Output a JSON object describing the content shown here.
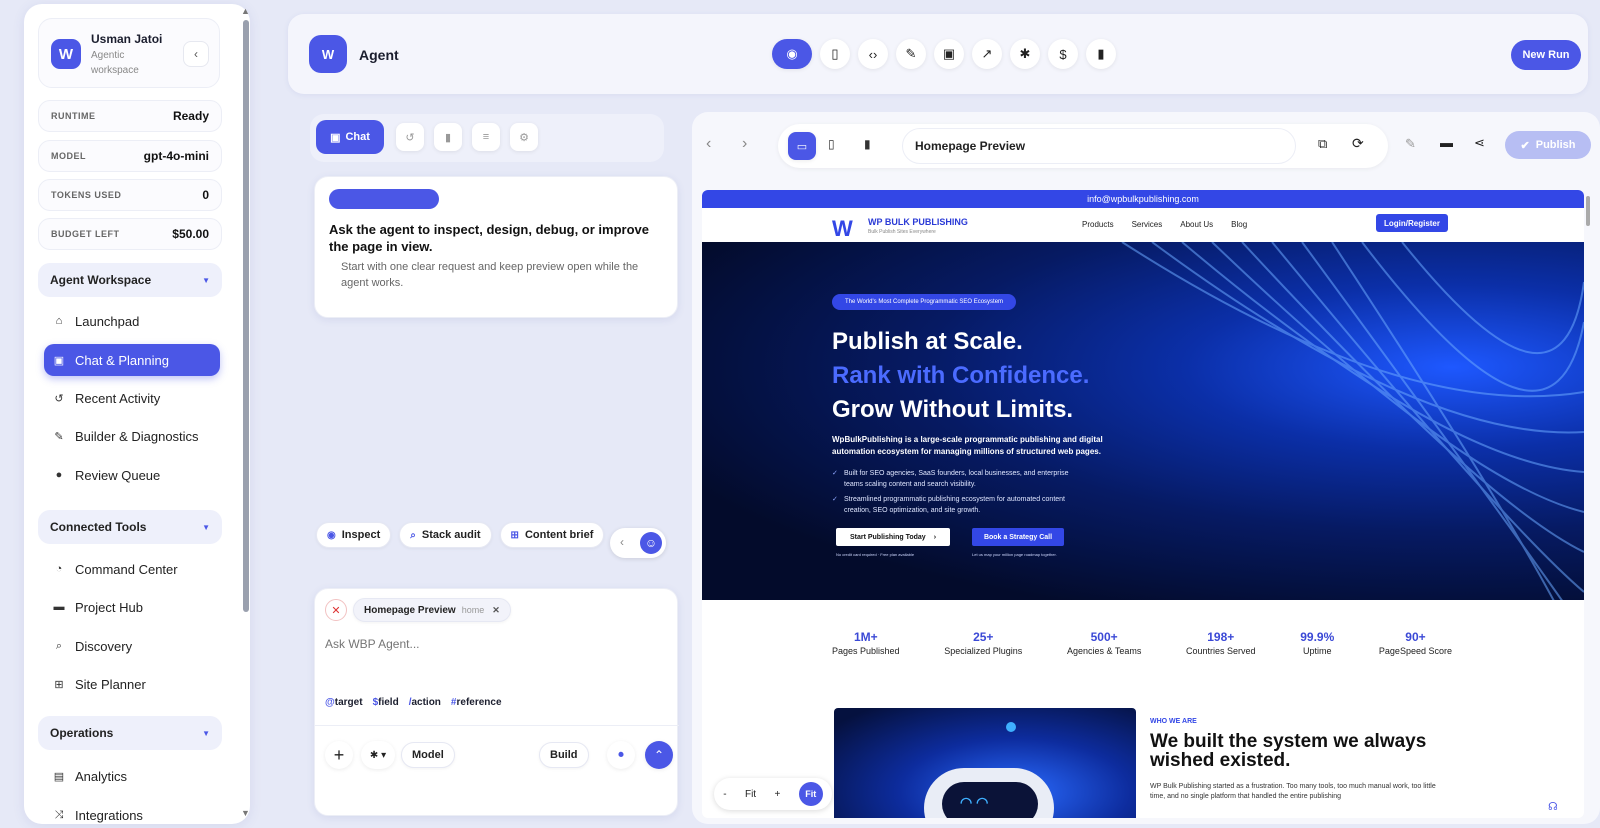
{
  "sidebar": {
    "user": {
      "initial": "W",
      "name": "Usman Jatoi",
      "subtitle": "Agentic workspace"
    },
    "stats": [
      {
        "key": "RUNTIME",
        "value": "Ready"
      },
      {
        "key": "MODEL",
        "value": "gpt-4o-mini"
      },
      {
        "key": "TOKENS USED",
        "value": "0"
      },
      {
        "key": "BUDGET LEFT",
        "value": "$50.00"
      }
    ],
    "sections": [
      {
        "title": "Agent Workspace",
        "items": [
          {
            "label": "Launchpad",
            "icon": "home-icon"
          },
          {
            "label": "Chat & Planning",
            "icon": "chat-icon",
            "active": true
          },
          {
            "label": "Recent Activity",
            "icon": "history-icon"
          },
          {
            "label": "Builder & Diagnostics",
            "icon": "wrench-icon"
          },
          {
            "label": "Review Queue",
            "icon": "check-circle-icon"
          }
        ]
      },
      {
        "title": "Connected Tools",
        "items": [
          {
            "label": "Command Center",
            "icon": "gauge-icon"
          },
          {
            "label": "Project Hub",
            "icon": "folder-icon"
          },
          {
            "label": "Discovery",
            "icon": "search-icon"
          },
          {
            "label": "Site Planner",
            "icon": "sitemap-icon"
          }
        ]
      },
      {
        "title": "Operations",
        "items": [
          {
            "label": "Analytics",
            "icon": "chart-icon"
          },
          {
            "label": "Integrations",
            "icon": "shuffle-icon"
          }
        ]
      }
    ]
  },
  "topbar": {
    "initial": "W",
    "title": "Agent",
    "new_run": "New Run"
  },
  "chat": {
    "tab_label": "Chat",
    "prompt_title": "Ask the agent to inspect, design, debug, or improve the page in view.",
    "prompt_sub": "Start with one clear request and keep preview open while the agent works.",
    "quick_actions": [
      "Inspect",
      "Stack audit",
      "Content brief"
    ],
    "context_chip": {
      "label": "Homepage Preview",
      "tag": "home"
    },
    "input_placeholder": "Ask WBP Agent...",
    "hints": [
      {
        "sym": "@",
        "word": "target"
      },
      {
        "sym": "$",
        "word": "field"
      },
      {
        "sym": "/",
        "word": "action"
      },
      {
        "sym": "#",
        "word": "reference"
      }
    ],
    "model_label": "Model",
    "build_label": "Build"
  },
  "preview": {
    "address": "Homepage Preview",
    "publish": "Publish",
    "zoom": {
      "minus": "-",
      "fit": "Fit",
      "plus": "+",
      "fit_active": "Fit"
    }
  },
  "site": {
    "top_email": "info@wpbulkpublishing.com",
    "brand": "WP BULK PUBLISHING",
    "tagline": "Bulk Publish Sites Everywhere",
    "nav": [
      "Products",
      "Services",
      "About Us",
      "Blog"
    ],
    "login": "Login/Register",
    "badge": "The World's Most Complete Programmatic SEO Ecosystem",
    "h1": "Publish at Scale.",
    "h2": "Rank with Confidence.",
    "h3": "Grow Without Limits.",
    "desc": "WpBulkPublishing is a large-scale programmatic publishing and digital automation ecosystem for managing millions of structured web pages.",
    "bullets": [
      "Built for SEO agencies, SaaS founders, local businesses, and enterprise teams scaling content and search visibility.",
      "Streamlined programmatic publishing ecosystem for automated content creation, SEO optimization, and site growth."
    ],
    "cta1": "Start Publishing Today",
    "cta2": "Book a Strategy Call",
    "note1": "No credit card required · Free plan available",
    "note2": "Let us map your million page roadmap together.",
    "stats": [
      {
        "n": "1M+",
        "l": "Pages Published"
      },
      {
        "n": "25+",
        "l": "Specialized Plugins"
      },
      {
        "n": "500+",
        "l": "Agencies & Teams"
      },
      {
        "n": "198+",
        "l": "Countries Served"
      },
      {
        "n": "99.9%",
        "l": "Uptime"
      },
      {
        "n": "90+",
        "l": "PageSpeed Score"
      }
    ],
    "who_label": "WHO WE ARE",
    "who_title": "We built the system we always wished existed.",
    "who_text": "WP Bulk Publishing started as a frustration. Too many tools, too much manual work, too little time, and no single platform that handled the entire publishing"
  }
}
